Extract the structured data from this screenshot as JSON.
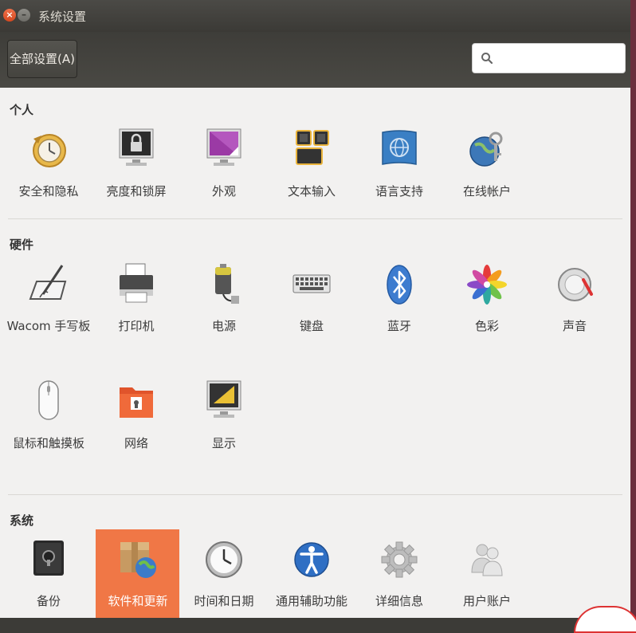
{
  "window": {
    "title": "系统设置"
  },
  "toolbar": {
    "all_settings_label": "全部设置(A)",
    "search_placeholder": ""
  },
  "sections": {
    "personal": {
      "title": "个人",
      "items": [
        {
          "label": "安全和隐私",
          "icon": "privacy-icon"
        },
        {
          "label": "亮度和锁屏",
          "icon": "lock-screen-icon"
        },
        {
          "label": "外观",
          "icon": "appearance-icon"
        },
        {
          "label": "文本输入",
          "icon": "text-entry-icon"
        },
        {
          "label": "语言支持",
          "icon": "language-icon"
        },
        {
          "label": "在线帐户",
          "icon": "online-accounts-icon"
        }
      ]
    },
    "hardware": {
      "title": "硬件",
      "items": [
        {
          "label": "Wacom 手写板",
          "icon": "wacom-tablet-icon"
        },
        {
          "label": "打印机",
          "icon": "printer-icon"
        },
        {
          "label": "电源",
          "icon": "power-icon"
        },
        {
          "label": "键盘",
          "icon": "keyboard-icon"
        },
        {
          "label": "蓝牙",
          "icon": "bluetooth-icon"
        },
        {
          "label": "色彩",
          "icon": "color-icon"
        },
        {
          "label": "声音",
          "icon": "sound-icon"
        },
        {
          "label": "鼠标和触摸板",
          "icon": "mouse-icon"
        },
        {
          "label": "网络",
          "icon": "network-icon"
        },
        {
          "label": "显示",
          "icon": "display-icon"
        }
      ]
    },
    "system": {
      "title": "系统",
      "items": [
        {
          "label": "备份",
          "icon": "backup-icon"
        },
        {
          "label": "软件和更新",
          "icon": "software-updates-icon",
          "selected": true
        },
        {
          "label": "时间和日期",
          "icon": "clock-icon"
        },
        {
          "label": "通用辅助功能",
          "icon": "accessibility-icon"
        },
        {
          "label": "详细信息",
          "icon": "details-icon"
        },
        {
          "label": "用户账户",
          "icon": "user-accounts-icon"
        }
      ]
    }
  },
  "colors": {
    "selection": "#f07746",
    "titlebar": "#3c3b37",
    "background": "#f2f1f0"
  }
}
